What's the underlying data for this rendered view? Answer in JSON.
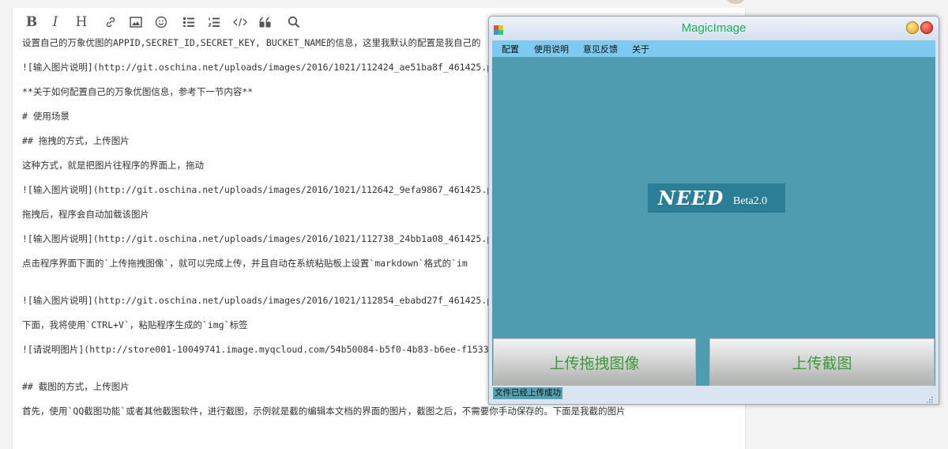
{
  "toolbar": {
    "bold": "B",
    "italic": "I",
    "heading": "H"
  },
  "editor": {
    "lines": [
      "设置自己的万象优图的APPID,SECRET_ID,SECRET_KEY, BUCKET_NAME的信息，这里我默认的配置是我自己的",
      "![输入图片说明](http://git.oschina.net/uploads/images/2016/1021/112424_ae51ba8f_461425.pr",
      "**关于如何配置自己的万象优图信息，参考下一节内容**",
      "# 使用场景",
      "## 拖拽的方式，上传图片",
      "这种方式，就是把图片往程序的界面上，拖动",
      "![输入图片说明](http://git.oschina.net/uploads/images/2016/1021/112642_9efa9867_461425.pr",
      "拖拽后，程序会自动加载该图片",
      "![输入图片说明](http://git.oschina.net/uploads/images/2016/1021/112738_24bb1a08_461425.pr",
      "点击程序界面下面的`上传拖拽图像`，就可以完成上传，并且自动在系统粘贴板上设置`markdown`格式的`im",
      "![输入图片说明](http://git.oschina.net/uploads/images/2016/1021/112854_ebabd27f_461425.pr",
      "下面，我将使用`CTRL+V`，粘贴程序生成的`img`标签",
      "![请说明图片](http://store001-10049741.image.myqcloud.com/54b50084-b5f0-4b83-b6ee-f1533e",
      "## 截图的方式，上传图片",
      "首先，使用`QQ截图功能`或者其他截图软件，进行截图，示例就是截的编辑本文档的界面的图片，截图之后，不需要你手动保存的。下面是我截的图片"
    ]
  },
  "window": {
    "title": "MagicImage",
    "menu": [
      "配置",
      "使用说明",
      "意见反馈",
      "关于"
    ],
    "logo_main": "NEED",
    "logo_version": "Beta2.0",
    "upload_drag_label": "上传拖拽图像",
    "upload_screenshot_label": "上传截图",
    "status": "文件已经上传成功",
    "colors": {
      "client": "#4f9cb1",
      "menubar": "#7dc9f0",
      "title_text": "#1fae5a",
      "button_text": "#3a9a3a"
    }
  }
}
